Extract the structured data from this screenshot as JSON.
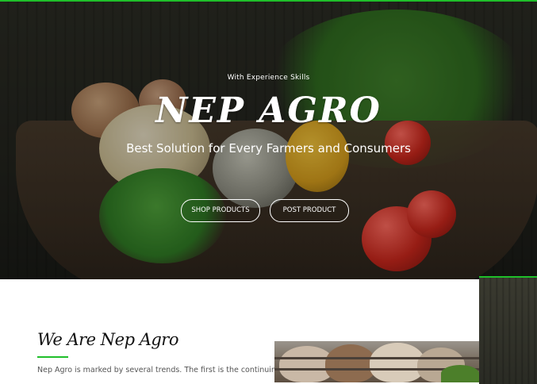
{
  "hero": {
    "tagline": "With Experience Skills",
    "title": "NEP AGRO",
    "subtitle": "Best Solution for Every Farmers and Consumers",
    "buttons": {
      "shop": "SHOP PRODUCTS",
      "post": "POST PRODUCT"
    }
  },
  "about": {
    "title": "We Are Nep Agro",
    "text": "Nep Agro is marked by several trends. The first is the continuing"
  },
  "colors": {
    "accent": "#1fbf2a",
    "hero_overlay": "#22231d",
    "text_dark": "#111111",
    "text_body": "#555555"
  }
}
